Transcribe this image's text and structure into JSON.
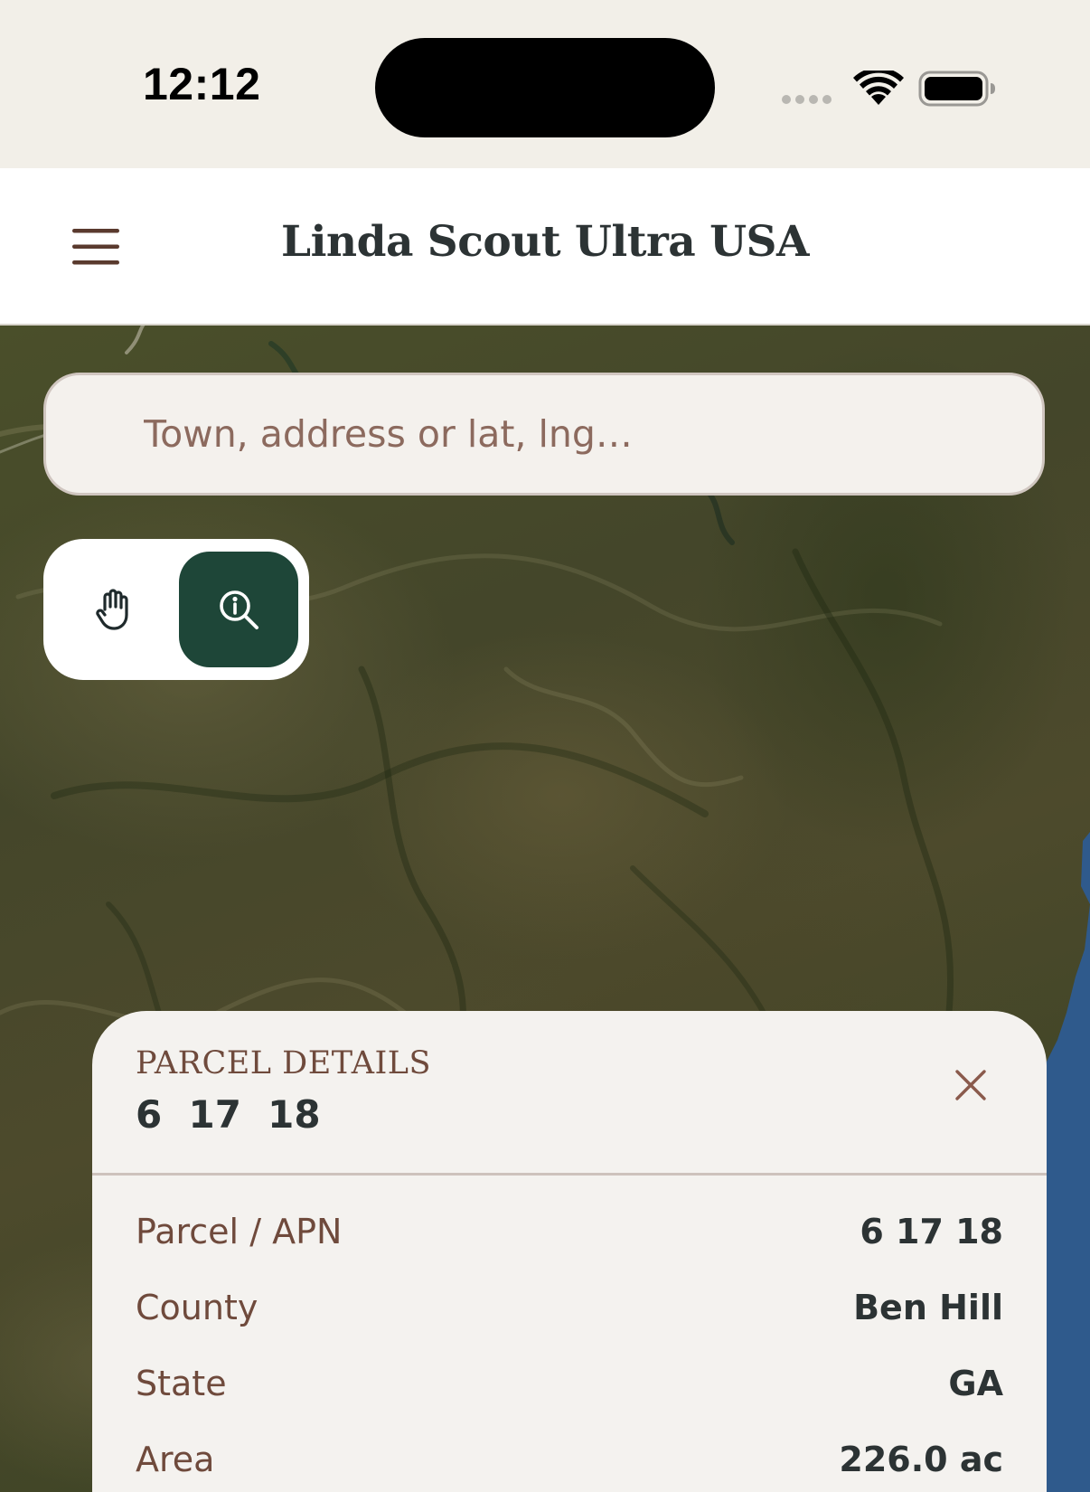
{
  "status_bar": {
    "time": "12:12",
    "wifi_icon": "wifi-icon",
    "battery_icon": "battery-icon"
  },
  "header": {
    "title": "Linda Scout Ultra USA",
    "menu_icon": "hamburger-menu-icon"
  },
  "search": {
    "placeholder": "Town, address or lat, lng…",
    "value": ""
  },
  "mode_toggle": {
    "pan_icon": "hand-icon",
    "identify_icon": "info-magnifier-icon",
    "active_mode": "identify",
    "active_color": "#1e4638"
  },
  "parcel_panel": {
    "kicker": "PARCEL DETAILS",
    "title": "6  17  18",
    "close_icon": "close-icon",
    "rows": [
      {
        "label": "Parcel / APN",
        "value": "6 17 18"
      },
      {
        "label": "County",
        "value": "Ben Hill"
      },
      {
        "label": "State",
        "value": "GA"
      },
      {
        "label": "Area",
        "value": "226.0 ac"
      }
    ]
  },
  "colors": {
    "accent_dark_green": "#1e4638",
    "label_brown": "#6f4a3c",
    "placeholder_brown": "#8c6a5e",
    "text_dark": "#2c3334"
  }
}
